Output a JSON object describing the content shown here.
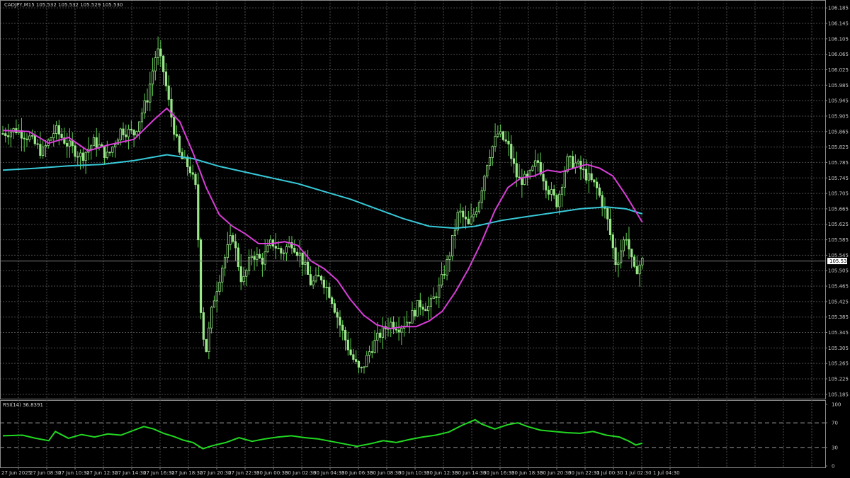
{
  "colors": {
    "background": "#000000",
    "grid": "#4a4a4a",
    "frame": "#8a8a8a",
    "candle": "#9ae88a",
    "wick": "#5cd04e",
    "ma_fast": "#d93ed9",
    "ma_slow": "#38c8d8",
    "rsi": "#22d822",
    "bid_line": "#7a7a7a",
    "text": "#c8c8c8"
  },
  "header": {
    "symbol_line": "CADJPY,M15  105.532 105.532 105.529 105.530"
  },
  "chart_data": [
    {
      "type": "candlestick",
      "symbol": "CADJPY",
      "timeframe": "M15",
      "ohlc_header": {
        "open": 105.532,
        "high": 105.532,
        "low": 105.529,
        "close": 105.53
      },
      "last_price": 105.53,
      "last_price_label": "105.530",
      "ylim": [
        105.185,
        106.185
      ],
      "y_ticks": [
        "106.185",
        "106.145",
        "106.105",
        "106.065",
        "106.025",
        "105.985",
        "105.945",
        "105.905",
        "105.865",
        "105.825",
        "105.785",
        "105.745",
        "105.705",
        "105.665",
        "105.625",
        "105.585",
        "105.545",
        "105.505",
        "105.465",
        "105.425",
        "105.385",
        "105.345",
        "105.305",
        "105.265",
        "105.225",
        "105.185"
      ],
      "x_ticks": [
        "27 Jun 2025",
        "27 Jun 08:30",
        "27 Jun 10:30",
        "27 Jun 12:30",
        "27 Jun 14:30",
        "27 Jun 16:30",
        "27 Jun 18:30",
        "27 Jun 20:30",
        "27 Jun 22:30",
        "30 Jun 00:30",
        "30 Jun 02:30",
        "30 Jun 04:30",
        "30 Jun 06:30",
        "30 Jun 08:30",
        "30 Jun 10:30",
        "30 Jun 12:30",
        "30 Jun 14:30",
        "30 Jun 16:30",
        "30 Jun 18:30",
        "30 Jun 20:30",
        "30 Jun 22:30",
        "1 Jul 00:30",
        "1 Jul 02:30",
        "1 Jul 04:30"
      ],
      "grid": true,
      "price_path": [
        {
          "x": 0,
          "p": 105.86
        },
        {
          "x": 0.02,
          "p": 105.87
        },
        {
          "x": 0.04,
          "p": 105.85
        },
        {
          "x": 0.06,
          "p": 105.81
        },
        {
          "x": 0.08,
          "p": 105.87
        },
        {
          "x": 0.1,
          "p": 105.83
        },
        {
          "x": 0.12,
          "p": 105.8
        },
        {
          "x": 0.14,
          "p": 105.84
        },
        {
          "x": 0.16,
          "p": 105.8
        },
        {
          "x": 0.18,
          "p": 105.87
        },
        {
          "x": 0.2,
          "p": 105.86
        },
        {
          "x": 0.22,
          "p": 105.95
        },
        {
          "x": 0.235,
          "p": 106.08
        },
        {
          "x": 0.245,
          "p": 106.02
        },
        {
          "x": 0.255,
          "p": 105.92
        },
        {
          "x": 0.27,
          "p": 105.8
        },
        {
          "x": 0.285,
          "p": 105.77
        },
        {
          "x": 0.295,
          "p": 105.71
        },
        {
          "x": 0.303,
          "p": 105.36
        },
        {
          "x": 0.31,
          "p": 105.3
        },
        {
          "x": 0.32,
          "p": 105.42
        },
        {
          "x": 0.335,
          "p": 105.52
        },
        {
          "x": 0.35,
          "p": 105.6
        },
        {
          "x": 0.365,
          "p": 105.47
        },
        {
          "x": 0.38,
          "p": 105.55
        },
        {
          "x": 0.395,
          "p": 105.53
        },
        {
          "x": 0.41,
          "p": 105.58
        },
        {
          "x": 0.425,
          "p": 105.55
        },
        {
          "x": 0.44,
          "p": 105.58
        },
        {
          "x": 0.455,
          "p": 105.54
        },
        {
          "x": 0.47,
          "p": 105.47
        },
        {
          "x": 0.485,
          "p": 105.49
        },
        {
          "x": 0.5,
          "p": 105.44
        },
        {
          "x": 0.515,
          "p": 105.36
        },
        {
          "x": 0.53,
          "p": 105.29
        },
        {
          "x": 0.545,
          "p": 105.24
        },
        {
          "x": 0.56,
          "p": 105.3
        },
        {
          "x": 0.575,
          "p": 105.34
        },
        {
          "x": 0.59,
          "p": 105.37
        },
        {
          "x": 0.605,
          "p": 105.36
        },
        {
          "x": 0.62,
          "p": 105.38
        },
        {
          "x": 0.635,
          "p": 105.42
        },
        {
          "x": 0.65,
          "p": 105.41
        },
        {
          "x": 0.665,
          "p": 105.46
        },
        {
          "x": 0.68,
          "p": 105.54
        },
        {
          "x": 0.695,
          "p": 105.66
        },
        {
          "x": 0.71,
          "p": 105.62
        },
        {
          "x": 0.725,
          "p": 105.68
        },
        {
          "x": 0.74,
          "p": 105.8
        },
        {
          "x": 0.755,
          "p": 105.86
        },
        {
          "x": 0.77,
          "p": 105.83
        },
        {
          "x": 0.785,
          "p": 105.74
        },
        {
          "x": 0.8,
          "p": 105.74
        },
        {
          "x": 0.815,
          "p": 105.79
        },
        {
          "x": 0.83,
          "p": 105.72
        },
        {
          "x": 0.845,
          "p": 105.68
        },
        {
          "x": 0.86,
          "p": 105.79
        },
        {
          "x": 0.875,
          "p": 105.78
        },
        {
          "x": 0.89,
          "p": 105.75
        },
        {
          "x": 0.905,
          "p": 105.72
        },
        {
          "x": 0.92,
          "p": 105.65
        },
        {
          "x": 0.935,
          "p": 105.52
        },
        {
          "x": 0.95,
          "p": 105.6
        },
        {
          "x": 0.962,
          "p": 105.5
        },
        {
          "x": 0.975,
          "p": 105.53
        },
        {
          "x": 1.0,
          "p": 105.53
        }
      ],
      "ma_fast": [
        {
          "x": 0,
          "p": 105.868
        },
        {
          "x": 0.04,
          "p": 105.865
        },
        {
          "x": 0.07,
          "p": 105.835
        },
        {
          "x": 0.1,
          "p": 105.85
        },
        {
          "x": 0.13,
          "p": 105.815
        },
        {
          "x": 0.16,
          "p": 105.83
        },
        {
          "x": 0.2,
          "p": 105.845
        },
        {
          "x": 0.23,
          "p": 105.895
        },
        {
          "x": 0.25,
          "p": 105.925
        },
        {
          "x": 0.27,
          "p": 105.89
        },
        {
          "x": 0.29,
          "p": 105.81
        },
        {
          "x": 0.31,
          "p": 105.72
        },
        {
          "x": 0.33,
          "p": 105.65
        },
        {
          "x": 0.35,
          "p": 105.62
        },
        {
          "x": 0.37,
          "p": 105.6
        },
        {
          "x": 0.39,
          "p": 105.575
        },
        {
          "x": 0.41,
          "p": 105.575
        },
        {
          "x": 0.43,
          "p": 105.58
        },
        {
          "x": 0.45,
          "p": 105.57
        },
        {
          "x": 0.47,
          "p": 105.53
        },
        {
          "x": 0.49,
          "p": 105.51
        },
        {
          "x": 0.51,
          "p": 105.48
        },
        {
          "x": 0.53,
          "p": 105.43
        },
        {
          "x": 0.55,
          "p": 105.39
        },
        {
          "x": 0.57,
          "p": 105.365
        },
        {
          "x": 0.59,
          "p": 105.355
        },
        {
          "x": 0.61,
          "p": 105.36
        },
        {
          "x": 0.63,
          "p": 105.36
        },
        {
          "x": 0.65,
          "p": 105.375
        },
        {
          "x": 0.67,
          "p": 105.4
        },
        {
          "x": 0.69,
          "p": 105.45
        },
        {
          "x": 0.71,
          "p": 105.51
        },
        {
          "x": 0.73,
          "p": 105.58
        },
        {
          "x": 0.75,
          "p": 105.66
        },
        {
          "x": 0.77,
          "p": 105.72
        },
        {
          "x": 0.79,
          "p": 105.745
        },
        {
          "x": 0.81,
          "p": 105.75
        },
        {
          "x": 0.83,
          "p": 105.765
        },
        {
          "x": 0.85,
          "p": 105.76
        },
        {
          "x": 0.87,
          "p": 105.77
        },
        {
          "x": 0.89,
          "p": 105.78
        },
        {
          "x": 0.91,
          "p": 105.77
        },
        {
          "x": 0.93,
          "p": 105.75
        },
        {
          "x": 0.95,
          "p": 105.7
        },
        {
          "x": 0.975,
          "p": 105.63
        }
      ],
      "ma_slow": [
        {
          "x": 0,
          "p": 105.765
        },
        {
          "x": 0.05,
          "p": 105.77
        },
        {
          "x": 0.1,
          "p": 105.776
        },
        {
          "x": 0.15,
          "p": 105.78
        },
        {
          "x": 0.2,
          "p": 105.79
        },
        {
          "x": 0.25,
          "p": 105.805
        },
        {
          "x": 0.29,
          "p": 105.795
        },
        {
          "x": 0.33,
          "p": 105.775
        },
        {
          "x": 0.37,
          "p": 105.76
        },
        {
          "x": 0.41,
          "p": 105.745
        },
        {
          "x": 0.45,
          "p": 105.73
        },
        {
          "x": 0.49,
          "p": 105.71
        },
        {
          "x": 0.53,
          "p": 105.69
        },
        {
          "x": 0.57,
          "p": 105.665
        },
        {
          "x": 0.61,
          "p": 105.64
        },
        {
          "x": 0.65,
          "p": 105.62
        },
        {
          "x": 0.69,
          "p": 105.615
        },
        {
          "x": 0.72,
          "p": 105.62
        },
        {
          "x": 0.76,
          "p": 105.635
        },
        {
          "x": 0.8,
          "p": 105.645
        },
        {
          "x": 0.84,
          "p": 105.655
        },
        {
          "x": 0.88,
          "p": 105.665
        },
        {
          "x": 0.92,
          "p": 105.67
        },
        {
          "x": 0.95,
          "p": 105.665
        },
        {
          "x": 0.975,
          "p": 105.652
        }
      ]
    },
    {
      "type": "line",
      "title": "RSI(14) 36.8391",
      "value": 36.8391,
      "ylim": [
        0,
        100
      ],
      "y_ticks": [
        "100",
        "70",
        "30",
        "0"
      ],
      "levels": [
        70,
        30
      ],
      "values": [
        {
          "x": 0,
          "v": 49
        },
        {
          "x": 0.03,
          "v": 50
        },
        {
          "x": 0.05,
          "v": 45
        },
        {
          "x": 0.07,
          "v": 41
        },
        {
          "x": 0.08,
          "v": 56
        },
        {
          "x": 0.1,
          "v": 45
        },
        {
          "x": 0.12,
          "v": 51
        },
        {
          "x": 0.14,
          "v": 47
        },
        {
          "x": 0.16,
          "v": 52
        },
        {
          "x": 0.18,
          "v": 50
        },
        {
          "x": 0.2,
          "v": 58
        },
        {
          "x": 0.215,
          "v": 64
        },
        {
          "x": 0.23,
          "v": 60
        },
        {
          "x": 0.245,
          "v": 53
        },
        {
          "x": 0.26,
          "v": 48
        },
        {
          "x": 0.275,
          "v": 42
        },
        {
          "x": 0.29,
          "v": 38
        },
        {
          "x": 0.305,
          "v": 28
        },
        {
          "x": 0.32,
          "v": 33
        },
        {
          "x": 0.34,
          "v": 38
        },
        {
          "x": 0.36,
          "v": 46
        },
        {
          "x": 0.38,
          "v": 40
        },
        {
          "x": 0.4,
          "v": 44
        },
        {
          "x": 0.42,
          "v": 47
        },
        {
          "x": 0.44,
          "v": 49
        },
        {
          "x": 0.46,
          "v": 46
        },
        {
          "x": 0.48,
          "v": 44
        },
        {
          "x": 0.5,
          "v": 40
        },
        {
          "x": 0.52,
          "v": 36
        },
        {
          "x": 0.54,
          "v": 32
        },
        {
          "x": 0.56,
          "v": 36
        },
        {
          "x": 0.58,
          "v": 41
        },
        {
          "x": 0.6,
          "v": 38
        },
        {
          "x": 0.62,
          "v": 43
        },
        {
          "x": 0.64,
          "v": 47
        },
        {
          "x": 0.66,
          "v": 50
        },
        {
          "x": 0.68,
          "v": 55
        },
        {
          "x": 0.7,
          "v": 66
        },
        {
          "x": 0.72,
          "v": 75
        },
        {
          "x": 0.73,
          "v": 68
        },
        {
          "x": 0.75,
          "v": 60
        },
        {
          "x": 0.77,
          "v": 67
        },
        {
          "x": 0.785,
          "v": 70
        },
        {
          "x": 0.8,
          "v": 64
        },
        {
          "x": 0.82,
          "v": 58
        },
        {
          "x": 0.84,
          "v": 56
        },
        {
          "x": 0.86,
          "v": 54
        },
        {
          "x": 0.88,
          "v": 53
        },
        {
          "x": 0.9,
          "v": 56
        },
        {
          "x": 0.92,
          "v": 50
        },
        {
          "x": 0.94,
          "v": 47
        },
        {
          "x": 0.955,
          "v": 40
        },
        {
          "x": 0.965,
          "v": 34
        },
        {
          "x": 0.975,
          "v": 37
        }
      ]
    }
  ]
}
